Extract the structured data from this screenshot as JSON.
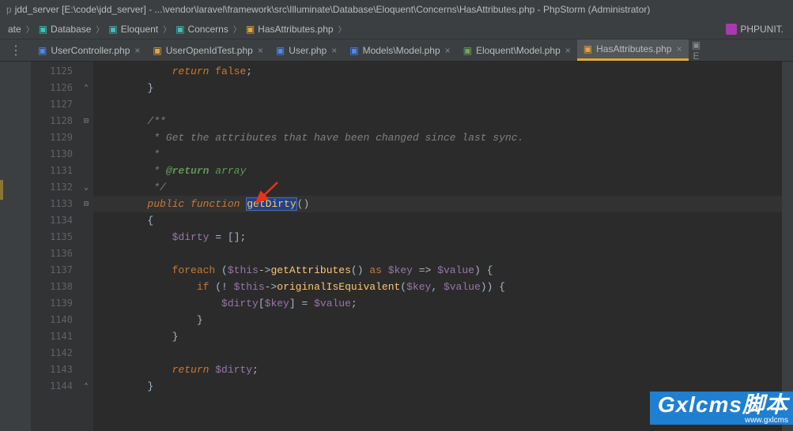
{
  "window": {
    "title": "jdd_server [E:\\code\\jdd_server] - ...\\vendor\\laravel\\framework\\src\\Illuminate\\Database\\Eloquent\\Concerns\\HasAttributes.php - PhpStorm (Administrator)"
  },
  "breadcrumbs": [
    {
      "label": "ate",
      "icon": "file"
    },
    {
      "label": "Database",
      "icon": "folder"
    },
    {
      "label": "Eloquent",
      "icon": "folder"
    },
    {
      "label": "Concerns",
      "icon": "folder"
    },
    {
      "label": "HasAttributes.php",
      "icon": "php-orange"
    }
  ],
  "phpunit_label": "PHPUNIT.",
  "tabs": [
    {
      "label": "UserController.php",
      "icon": "php-blue",
      "active": false
    },
    {
      "label": "UserOpenIdTest.php",
      "icon": "php-orange",
      "active": false
    },
    {
      "label": "User.php",
      "icon": "php-blue",
      "active": false
    },
    {
      "label": "Models\\Model.php",
      "icon": "php-blue",
      "active": false
    },
    {
      "label": "Eloquent\\Model.php",
      "icon": "php-green",
      "active": false
    },
    {
      "label": "HasAttributes.php",
      "icon": "php-orange",
      "active": true
    }
  ],
  "lines": {
    "start": 1125,
    "end": 1144
  },
  "code": {
    "l1125": {
      "indent": "            ",
      "kw": "return ",
      "val": "false",
      "semi": ";"
    },
    "l1126": {
      "indent": "        ",
      "brace": "}"
    },
    "l1128": {
      "indent": "        ",
      "text": "/**"
    },
    "l1129": {
      "indent": "         ",
      "text": "* Get the attributes that have been changed since last sync."
    },
    "l1130": {
      "indent": "         ",
      "text": "*"
    },
    "l1131": {
      "indent": "         ",
      "pre": "* ",
      "tag": "@return",
      "post": " array"
    },
    "l1132": {
      "indent": "         ",
      "text": "*/"
    },
    "l1133": {
      "indent": "        ",
      "kw1": "public ",
      "kw2": "function ",
      "fn": "getDirty",
      "rest": "()"
    },
    "l1134": {
      "indent": "        ",
      "brace": "{"
    },
    "l1135": {
      "indent": "            ",
      "var": "$dirty",
      "rest": " = [];"
    },
    "l1137": {
      "indent": "            ",
      "kw": "foreach ",
      "p1": "(",
      "this": "$this",
      "arrow": "->",
      "fn": "getAttributes",
      "p2": "() ",
      "as": "as ",
      "key": "$key",
      "arr": " => ",
      "val": "$value",
      "p3": ") {"
    },
    "l1138": {
      "indent": "                ",
      "kw": "if ",
      "p1": "(! ",
      "this": "$this",
      "arrow": "->",
      "fn": "originalIsEquivalent",
      "p2": "(",
      "key": "$key",
      "c": ", ",
      "val": "$value",
      "p3": ")) {"
    },
    "l1139": {
      "indent": "                    ",
      "var1": "$dirty",
      "br1": "[",
      "var2": "$key",
      "br2": "] = ",
      "var3": "$value",
      "semi": ";"
    },
    "l1140": {
      "indent": "                ",
      "brace": "}"
    },
    "l1141": {
      "indent": "            ",
      "brace": "}"
    },
    "l1143": {
      "indent": "            ",
      "kw": "return ",
      "var": "$dirty",
      "semi": ";"
    },
    "l1144": {
      "indent": "        ",
      "brace": "}"
    }
  },
  "watermark": {
    "main": "Gxlcms脚本",
    "sub": "www.gxlcms"
  }
}
